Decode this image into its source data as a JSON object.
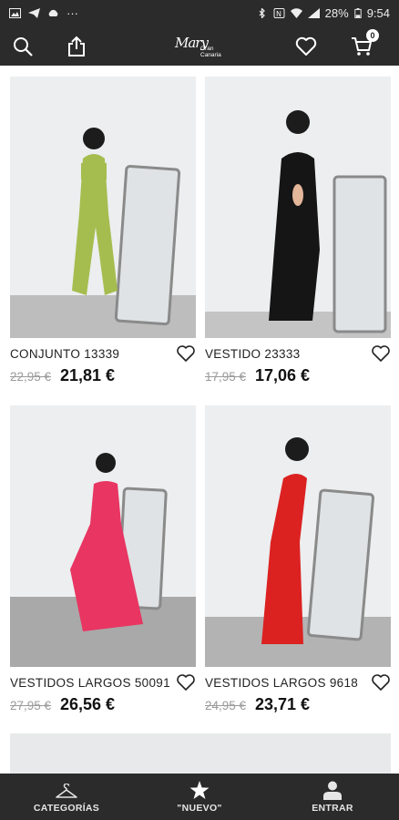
{
  "status_bar": {
    "battery": "28%",
    "time": "9:54",
    "more": "···"
  },
  "toolbar": {
    "logo_script": "Mary",
    "logo_sub_line1": "Gran",
    "logo_sub_line2": "Canaria",
    "cart_count": "0",
    "search_icon": "search-icon",
    "share_icon": "share-icon",
    "wishlist_icon": "heart-icon",
    "cart_icon": "cart-icon"
  },
  "products": [
    {
      "name": "CONJUNTO 13339",
      "old_price": "22,95 €",
      "price": "21,81 €",
      "dress_color": "#a5bd4e"
    },
    {
      "name": "VESTIDO 23333",
      "old_price": "17,95 €",
      "price": "17,06 €",
      "dress_color": "#151515"
    },
    {
      "name": "VESTIDOS LARGOS 50091",
      "old_price": "27,95 €",
      "price": "26,56 €",
      "dress_color": "#e83562"
    },
    {
      "name": "VESTIDOS LARGOS 9618",
      "old_price": "24,95 €",
      "price": "23,71 €",
      "dress_color": "#dc2121"
    }
  ],
  "bottom_nav": [
    {
      "label": "CATEGORÍAS",
      "icon": "hanger-icon"
    },
    {
      "label": "\"NUEVO\"",
      "icon": "star-icon"
    },
    {
      "label": "ENTRAR",
      "icon": "user-icon"
    }
  ],
  "colors": {
    "bar": "#2b2b2b",
    "wall": "#eceeef",
    "floor": "#bdbdbd"
  }
}
